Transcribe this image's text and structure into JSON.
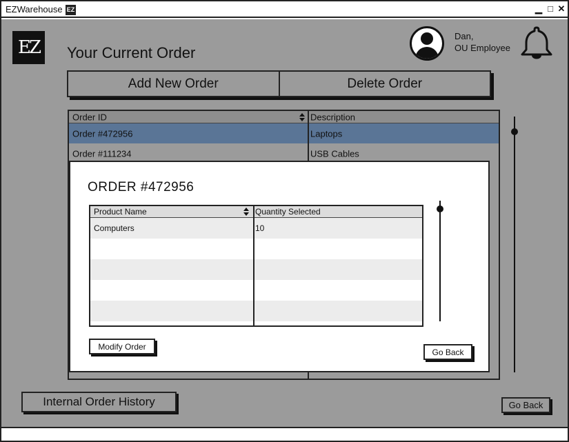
{
  "window": {
    "app_title": "EZWarehouse",
    "title_logo": "EZ",
    "minimize_glyph": "▁",
    "maximize_glyph": "□",
    "close_glyph": "✕"
  },
  "header": {
    "logo": "EZ",
    "page_title": "Your Current Order",
    "user_name": "Dan,",
    "user_role": "OU Employee",
    "avatar_icon": "user-avatar-icon",
    "notification_icon": "bell-icon"
  },
  "actions": {
    "add_label": "Add New Order",
    "delete_label": "Delete Order"
  },
  "orders_table": {
    "columns": [
      "Order ID",
      "Description"
    ],
    "rows": [
      {
        "id": "Order #472956",
        "description": "Laptops",
        "selected": true
      },
      {
        "id": "Order #111234",
        "description": "USB Cables",
        "selected": false
      }
    ]
  },
  "modal": {
    "title": "ORDER #472956",
    "columns": [
      "Product Name",
      "Quantity Selected"
    ],
    "rows": [
      {
        "product": "Computers",
        "quantity": "10"
      }
    ],
    "modify_label": "Modify Order",
    "go_back_label": "Go Back"
  },
  "footer": {
    "history_label": "Internal Order History",
    "go_back_label": "Go Back"
  },
  "colors": {
    "canvas": "#9b9b9b",
    "selected_row": "#5a7596",
    "stripe": "#ececec",
    "ink": "#111111"
  }
}
